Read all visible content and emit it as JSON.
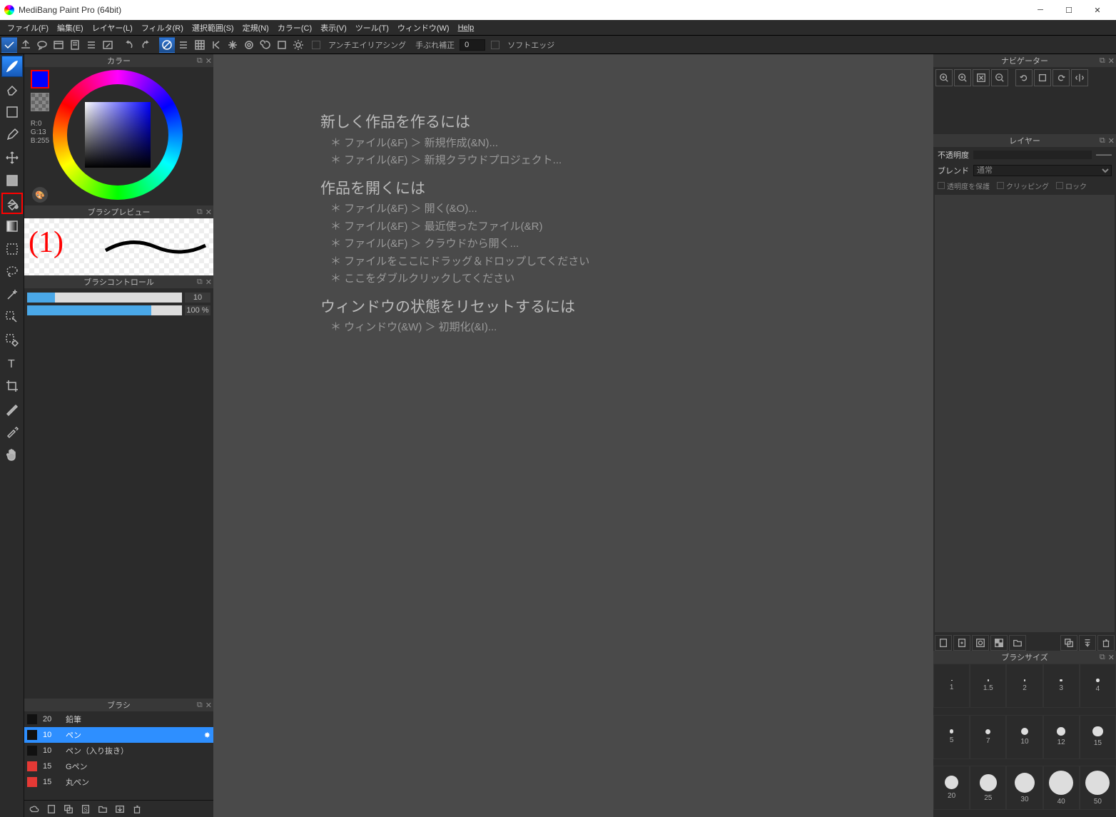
{
  "window": {
    "title": "MediBang Paint Pro (64bit)"
  },
  "menu": [
    "ファイル(F)",
    "編集(E)",
    "レイヤー(L)",
    "フィルタ(R)",
    "選択範囲(S)",
    "定規(N)",
    "カラー(C)",
    "表示(V)",
    "ツール(T)",
    "ウィンドウ(W)",
    "Help"
  ],
  "toolbar": {
    "antialias": "アンチエイリアシング",
    "stab_label": "手ぶれ補正",
    "stab_value": "0",
    "softedge": "ソフトエッジ"
  },
  "panels": {
    "color": "カラー",
    "brush_preview": "ブラシプレビュー",
    "brush_control": "ブラシコントロール",
    "brush": "ブラシ",
    "navigator": "ナビゲーター",
    "layer": "レイヤー",
    "brush_size": "ブラシサイズ"
  },
  "color": {
    "r": "R:0",
    "g": "G:13",
    "b": "B:255"
  },
  "annot": "(1)",
  "brush_control": {
    "val1": "10",
    "val2": "100 %",
    "pct1": 18,
    "pct2": 80
  },
  "brushes": [
    {
      "size": "20",
      "name": "鉛筆",
      "color": "black"
    },
    {
      "size": "10",
      "name": "ペン",
      "color": "black",
      "selected": true
    },
    {
      "size": "10",
      "name": "ペン（入り抜き）",
      "color": "black"
    },
    {
      "size": "15",
      "name": "Gペン",
      "color": "red"
    },
    {
      "size": "15",
      "name": "丸ペン",
      "color": "red"
    }
  ],
  "layer": {
    "opacity_label": "不透明度",
    "blend_label": "ブレンド",
    "blend_value": "通常",
    "protect": "透明度を保護",
    "clipping": "クリッピング",
    "lock": "ロック",
    "dashes": "——"
  },
  "sizes": [
    1,
    1.5,
    2,
    3,
    4,
    5,
    7,
    10,
    12,
    15,
    20,
    25,
    30,
    40,
    50
  ],
  "welcome": {
    "h1": "新しく作品を作るには",
    "l1": "＊ ファイル(&F) ＞ 新規作成(&N)...",
    "l2": "＊ ファイル(&F) ＞ 新規クラウドプロジェクト...",
    "h2": "作品を開くには",
    "o1": "＊ ファイル(&F) ＞ 開く(&O)...",
    "o2": "＊ ファイル(&F) ＞ 最近使ったファイル(&R)",
    "o3": "＊ ファイル(&F) ＞ クラウドから開く...",
    "o4": "＊ ファイルをここにドラッグ＆ドロップしてください",
    "o5": "＊ ここをダブルクリックしてください",
    "h3": "ウィンドウの状態をリセットするには",
    "r1": "＊ ウィンドウ(&W) ＞ 初期化(&I)..."
  }
}
